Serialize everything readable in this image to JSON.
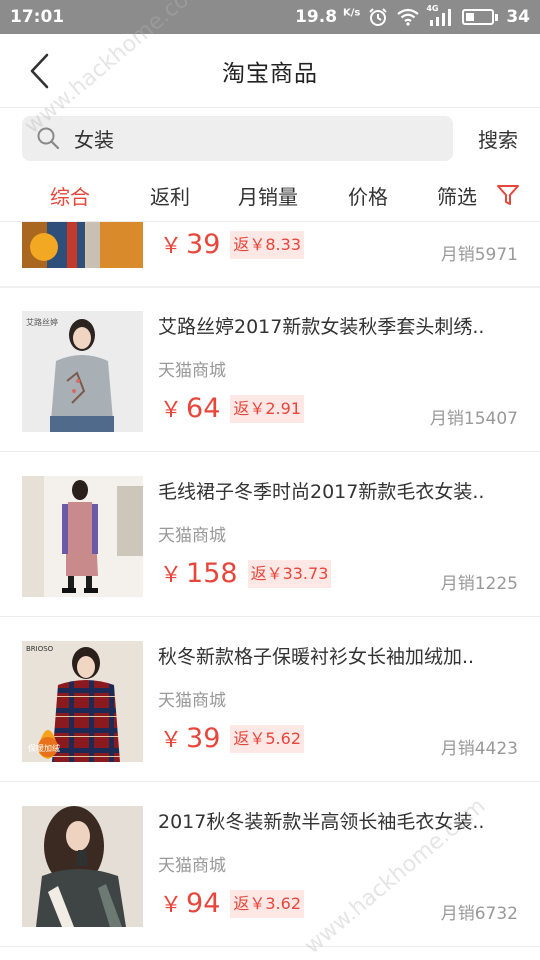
{
  "status_bar": {
    "time": "17:01",
    "speed_value": "19.8",
    "speed_unit": "K/s",
    "network_label": "4G",
    "battery_level": "34",
    "battery_fraction": 0.34,
    "icons": [
      "alarm-icon",
      "wifi-icon",
      "signal-icon",
      "battery-icon"
    ]
  },
  "header": {
    "title": "淘宝商品",
    "back_icon": "back-arrow-icon"
  },
  "search": {
    "value": "女装",
    "placeholder": "",
    "button_label": "搜索"
  },
  "tabs": [
    {
      "label": "综合",
      "active": true
    },
    {
      "label": "返利",
      "active": false
    },
    {
      "label": "月销量",
      "active": false
    },
    {
      "label": "价格",
      "active": false
    },
    {
      "label": "筛选",
      "active": false
    }
  ],
  "products": [
    {
      "title": "",
      "shop": "",
      "price": "39",
      "rebate": "返￥8.33",
      "sales": "月销5971",
      "currency": "￥"
    },
    {
      "title": "艾路丝婷2017新款女装秋季套头刺绣..",
      "shop": "天猫商城",
      "price": "64",
      "rebate": "返￥2.91",
      "sales": "月销15407",
      "currency": "￥"
    },
    {
      "title": "毛线裙子冬季时尚2017新款毛衣女装..",
      "shop": "天猫商城",
      "price": "158",
      "rebate": "返￥33.73",
      "sales": "月销1225",
      "currency": "￥"
    },
    {
      "title": "秋冬新款格子保暖衬衫女长袖加绒加..",
      "shop": "天猫商城",
      "price": "39",
      "rebate": "返￥5.62",
      "sales": "月销4423",
      "currency": "￥"
    },
    {
      "title": "2017秋冬装新款半高领长袖毛衣女装..",
      "shop": "天猫商城",
      "price": "94",
      "rebate": "返￥3.62",
      "sales": "月销6732",
      "currency": "￥"
    }
  ],
  "thumb_labels": {
    "p1_brand": "艾路丝婷",
    "p3_brand": "BRIOSO",
    "p3_badge": "保暖加绒"
  },
  "colors": {
    "accent": "#e8463b",
    "rebate_bg": "#fde8e6",
    "status_bar": "#8c8c8c",
    "search_bg": "#eeeeee"
  },
  "watermark": "www.hackhome.com"
}
